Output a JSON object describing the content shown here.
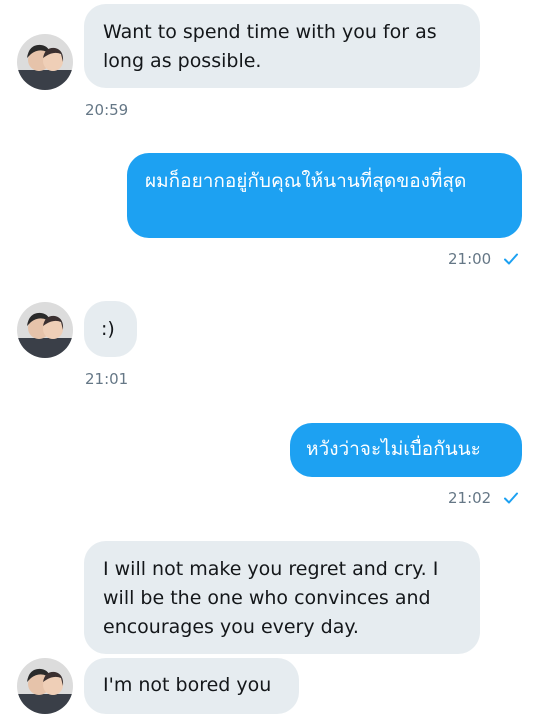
{
  "messages": [
    {
      "direction": "incoming",
      "text": "Want to spend time with you for as long as possible.",
      "time": "20:59"
    },
    {
      "direction": "outgoing",
      "text": "ผมก็อยากอยู่กับคุณให้นานที่สุดของที่สุด",
      "time": "21:00",
      "status_icon": "check-icon"
    },
    {
      "direction": "incoming",
      "text": ":)",
      "time": "21:01"
    },
    {
      "direction": "outgoing",
      "text": "หวังว่าจะไม่เบื่อกันนะ",
      "time": "21:02",
      "status_icon": "check-icon"
    },
    {
      "direction": "incoming",
      "text": "I will not make you regret and cry. I will be the one who convinces and encourages you every day."
    },
    {
      "direction": "incoming",
      "text": "I'm not bored you"
    }
  ],
  "colors": {
    "incoming_bubble": "#e6ecf0",
    "outgoing_bubble": "#1da1f2",
    "timestamp": "#657786",
    "read_check": "#1da1f2"
  }
}
